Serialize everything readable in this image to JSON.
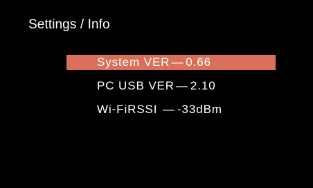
{
  "colors": {
    "background": "#000000",
    "text": "#ffffff",
    "selection": "#d9715a"
  },
  "header": {
    "title": "Settings / Info"
  },
  "menu": {
    "selected_index": 0,
    "items": [
      {
        "label": "System VER",
        "separator": "—",
        "value": "0.66"
      },
      {
        "label": "PC USB VER",
        "separator": "—",
        "value": "2.10"
      },
      {
        "label": "Wi-FiRSSI ",
        "separator": "—",
        "value": "-33dBm"
      }
    ]
  }
}
